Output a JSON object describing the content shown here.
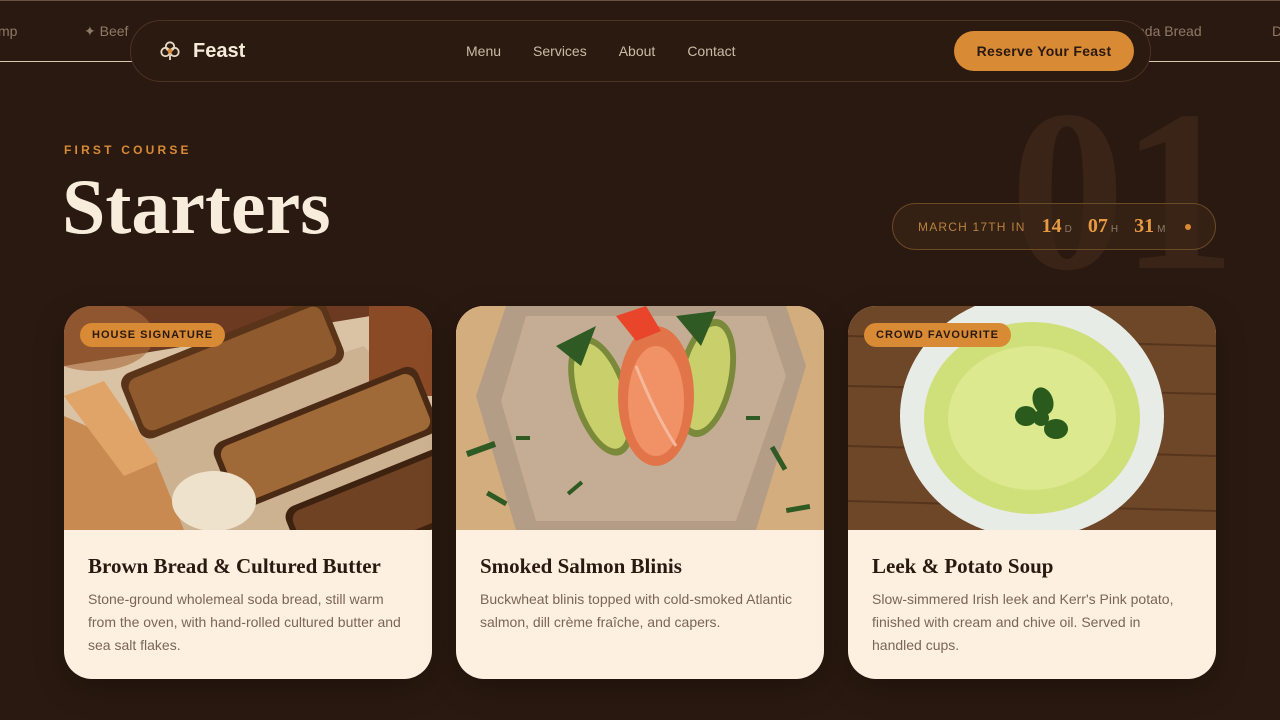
{
  "marquee": {
    "items": [
      "mp",
      "✦ Beef",
      "oda Bread",
      "D"
    ]
  },
  "nav": {
    "brand": "Feast",
    "brand_icon": "clover-icon",
    "links": [
      "Menu",
      "Services",
      "About",
      "Contact"
    ],
    "cta": "Reserve Your Feast"
  },
  "hero": {
    "eyebrow": "FIRST COURSE",
    "title": "Starters",
    "section_number": "01"
  },
  "countdown": {
    "label": "MARCH 17TH IN",
    "days": "14",
    "days_unit": "D",
    "hours": "07",
    "hours_unit": "H",
    "minutes": "31",
    "minutes_unit": "M"
  },
  "cards": [
    {
      "badge": "HOUSE SIGNATURE",
      "title": "Brown Bread & Cultured Butter",
      "description": "Stone-ground wholemeal soda bread, still warm from the oven, with hand-rolled cultured butter and sea salt flakes."
    },
    {
      "badge": "",
      "title": "Smoked Salmon Blinis",
      "description": "Buckwheat blinis topped with cold-smoked Atlantic salmon, dill crème fraîche, and capers."
    },
    {
      "badge": "CROWD FAVOURITE",
      "title": "Leek & Potato Soup",
      "description": "Slow-simmered Irish leek and Kerr's Pink potato, finished with cream and chive oil. Served in handled cups."
    }
  ],
  "colors": {
    "background": "#2a1910",
    "accent": "#d98a35",
    "card": "#fdf0e0",
    "heading": "#f8ecdc"
  }
}
